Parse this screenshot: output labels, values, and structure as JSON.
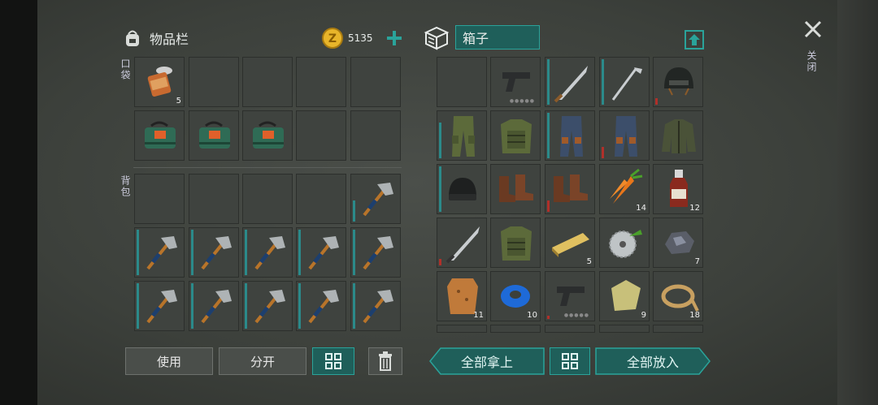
{
  "inventory": {
    "title": "物品栏",
    "coins": "5135",
    "pocket_label": "口袋",
    "backpack_label": "背包",
    "pocket_counts": [
      "5"
    ]
  },
  "box": {
    "title": "箱子",
    "counts": {
      "carrot": "14",
      "bottle": "12",
      "plank": "5",
      "ore": "7",
      "leather": "11",
      "tape": "10",
      "cloth": "9",
      "rope": "18"
    }
  },
  "close_label": "关闭",
  "buttons": {
    "use": "使用",
    "split": "分开",
    "take_all": "全部拿上",
    "put_all": "全部放入"
  },
  "colors": {
    "accent": "#2aa39a",
    "coin": "#e8b52a"
  }
}
